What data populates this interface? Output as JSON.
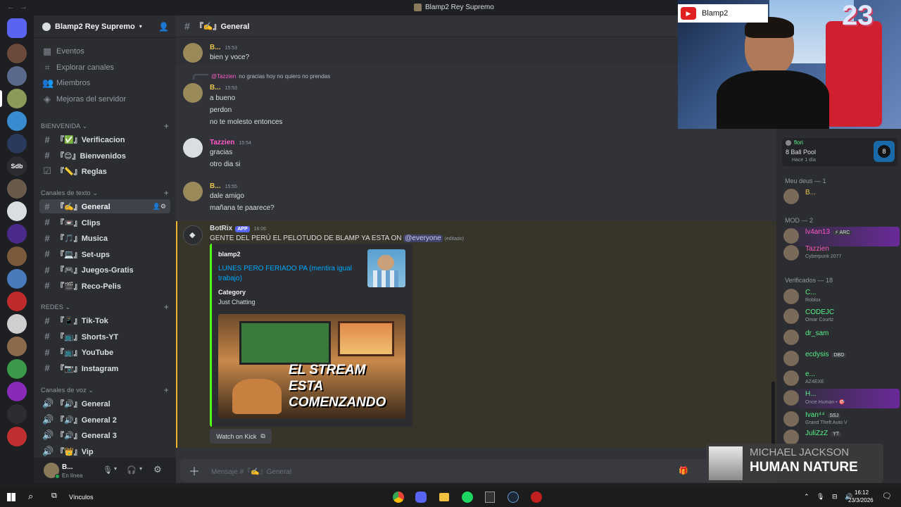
{
  "window": {
    "title": "Blamp2 Rey Supremo"
  },
  "server": {
    "name": "Blamp2 Rey Supremo"
  },
  "guilds": [
    {
      "label": "",
      "color": "#5865f2"
    },
    {
      "label": "",
      "color": "#6a4a3a"
    },
    {
      "label": "",
      "color": "#5a6a8a"
    },
    {
      "label": "",
      "color": "#8a9a5a"
    },
    {
      "label": "",
      "color": "#3a8acf"
    },
    {
      "label": "",
      "color": "#2a3a5a"
    },
    {
      "label": "Sdb",
      "color": "#2b2d31"
    },
    {
      "label": "",
      "color": "#6a5a4a"
    },
    {
      "label": "",
      "color": "#dbdee1"
    },
    {
      "label": "",
      "color": "#4a2a8a"
    },
    {
      "label": "",
      "color": "#7a5a3a"
    },
    {
      "label": "",
      "color": "#4a7aba"
    },
    {
      "label": "",
      "color": "#c02a2a"
    },
    {
      "label": "",
      "color": "#cfcfcf"
    },
    {
      "label": "",
      "color": "#8a6a4a"
    },
    {
      "label": "",
      "color": "#3a9a4a"
    },
    {
      "label": "",
      "color": "#8a2aba"
    },
    {
      "label": "",
      "color": "#2b2d31"
    },
    {
      "label": "",
      "color": "#c03030"
    }
  ],
  "sidebar": {
    "top": [
      {
        "label": "Eventos"
      },
      {
        "label": "Explorar canales"
      },
      {
        "label": "Miembros"
      },
      {
        "label": "Mejoras del servidor"
      }
    ],
    "cat_bienvenida": "BIENVENIDA",
    "bienvenida": [
      {
        "label": "『✅』Verificacion"
      },
      {
        "label": "『😊』Bienvenidos"
      },
      {
        "label": "『📏』Reglas"
      }
    ],
    "cat_texto": "Canales de texto",
    "texto": [
      {
        "label": "『✍️』General"
      },
      {
        "label": "『📼』Clips"
      },
      {
        "label": "『🎵』Musica"
      },
      {
        "label": "『💻』Set-ups"
      },
      {
        "label": "『🎮』Juegos-Gratis"
      },
      {
        "label": "『🎬』Reco-Pelis"
      }
    ],
    "cat_redes": "REDES",
    "redes": [
      {
        "label": "『📱』Tik-Tok"
      },
      {
        "label": "『📺』Shorts-YT"
      },
      {
        "label": "『📺』YouTube"
      },
      {
        "label": "『📷』Instagram"
      }
    ],
    "cat_voz": "Canales de voz",
    "voz": [
      {
        "label": "『🔊』General"
      },
      {
        "label": "『🔊』General 2"
      },
      {
        "label": "『🔊』General 3"
      },
      {
        "label": "『👑』Vip"
      }
    ]
  },
  "user": {
    "name": "B...",
    "status": "En línea"
  },
  "channel": {
    "name": "『✍️』General",
    "placeholder": "Mensaje #『✍️』General"
  },
  "messages": {
    "m1": {
      "author": "B...",
      "time": "15:53",
      "lines": [
        "bien y voce?"
      ]
    },
    "m2": {
      "reply_to": "@Tazzien",
      "reply_text": "no gracias hoy no quiero no prendas",
      "author": "B...",
      "time": "15:53",
      "lines": [
        "a bueno",
        "perdon",
        "no te molesto entonces"
      ]
    },
    "m3": {
      "author": "Tazzien",
      "time": "15:54",
      "lines": [
        "gracias",
        "otro dia si"
      ]
    },
    "m4": {
      "author": "B...",
      "time": "15:55",
      "lines": [
        "dale amigo",
        "mañana te paarece?"
      ]
    },
    "m5": {
      "author": "BotRix",
      "badge": "APP",
      "time": "16:06",
      "text": "GENTE DEL PERÚ EL PELOTUDO DE BLAMP YA ESTA ON",
      "mention": "@everyone",
      "edited": "(editado)"
    }
  },
  "embed": {
    "author": "blamp2",
    "title": "LUNES PERO FERIADO PA (mentira igual trabajo)",
    "field_name": "Category",
    "field_value": "Just Chatting",
    "image_text": "EL STREAM ESTA COMENZANDO",
    "button": "Watch on Kick"
  },
  "members": {
    "activity": {
      "name": "flori",
      "game": "8 Ball Pool",
      "time": "Hace 1 día"
    },
    "cat1": "Meu deus — 1",
    "cat2": "MOD — 2",
    "cat3": "Verificados — 18",
    "list1": [
      {
        "name": "B...",
        "status": "",
        "color": "#e8c24a"
      }
    ],
    "list2": [
      {
        "name": "lv4an13",
        "status": "",
        "tag": "⚡ ARC",
        "color": "#ff5ac8"
      },
      {
        "name": "Tazzien",
        "status": "Cyberpunk 2077",
        "color": "#ff5ac8"
      }
    ],
    "list3": [
      {
        "name": "C...",
        "status": "Roblox",
        "color": "#57f287"
      },
      {
        "name": "CODEJC",
        "status": "Omar Courtz",
        "color": "#57f287"
      },
      {
        "name": "dr_sam",
        "status": "",
        "color": "#57f287"
      },
      {
        "name": "ecdysis",
        "status": "",
        "tag": "DBD",
        "color": "#57f287"
      },
      {
        "name": "e...",
        "status": "AZ4EXE",
        "color": "#57f287"
      },
      {
        "name": "H...",
        "status": "Once Human • 🎯",
        "color": "#57f287"
      },
      {
        "name": "Ivan⁴⁴",
        "status": "Grand Theft Auto V",
        "tag": "SSJ",
        "color": "#57f287"
      },
      {
        "name": "JuliZzZ",
        "status": "",
        "tag": "YT",
        "color": "#57f287"
      }
    ]
  },
  "webcam": {
    "channel": "Blamp2",
    "overlay": "23"
  },
  "nowplaying": {
    "artist": "MICHAEL JACKSON",
    "song": "HUMAN NATURE"
  },
  "taskbar": {
    "links": "Vínculos",
    "time": "16:12",
    "date": "23/3/2026"
  }
}
